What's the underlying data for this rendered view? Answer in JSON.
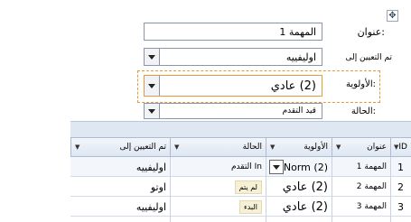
{
  "form": {
    "title_label": "عنوان:",
    "title_value": "المهمة 1",
    "assigned_label": "تم التعيين إلى",
    "assigned_value": "اوليفييه",
    "priority_label": "الأولوية:",
    "priority_value": "(2) عادي",
    "status_label": "الحالة:",
    "status_value": "قيد التقدم"
  },
  "grid": {
    "columns": {
      "id": "ID",
      "title": "عنوان",
      "priority": "الأولوية",
      "status": "الحالة",
      "assigned": "تم التعيين إلى"
    },
    "rows": [
      {
        "id": "1",
        "title": "المهمة 1",
        "priority": "(2) Norm",
        "status": "In التقدم",
        "assigned": "اوليفييه"
      },
      {
        "id": "2",
        "title": "المهمة 2",
        "priority": "(2) عادي",
        "status": "لم يتم",
        "assigned": "اوتو"
      },
      {
        "id": "3",
        "title": "المهمة 3",
        "priority": "(2) عادي",
        "status": "البدء",
        "assigned": "اوليفييه"
      }
    ]
  },
  "icons": {
    "move_handle": "move-handle-icon",
    "dropdown": "chevron-down-icon"
  },
  "colors": {
    "focus_border": "#e59a3a",
    "header_bg": "#dfe7f3",
    "status_chip": "#f6f0d6"
  }
}
